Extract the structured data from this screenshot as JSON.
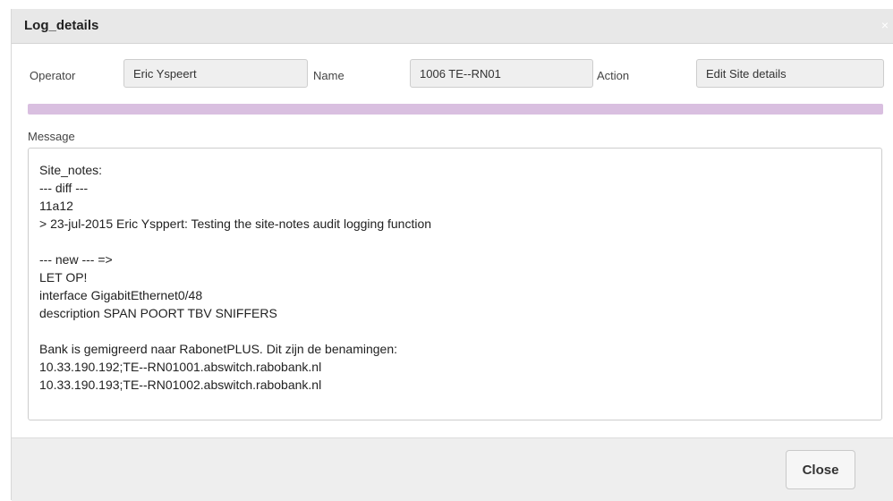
{
  "dialog": {
    "title": "Log_details",
    "close_icon": "×"
  },
  "fields": {
    "operator_label": "Operator",
    "operator_value": "Eric Yspeert",
    "name_label": "Name",
    "name_value": "1006 TE--RN01",
    "action_label": "Action",
    "action_value": "Edit Site details"
  },
  "progress": {
    "fraction": 1.0,
    "color": "#d9bfe0"
  },
  "message": {
    "label": "Message",
    "lines": [
      "Site_notes:",
      "--- diff ---",
      "11a12",
      "> 23-jul-2015 Eric Ysppert: Testing the site-notes audit logging function",
      "",
      "--- new --- =>",
      "LET OP!",
      "interface GigabitEthernet0/48",
      "description SPAN POORT TBV SNIFFERS",
      "",
      "Bank is gemigreerd naar RabonetPLUS. Dit zijn de benamingen:",
      "10.33.190.192;TE--RN01001.abswitch.rabobank.nl",
      "10.33.190.193;TE--RN01002.abswitch.rabobank.nl"
    ]
  },
  "footer": {
    "close_label": "Close"
  }
}
